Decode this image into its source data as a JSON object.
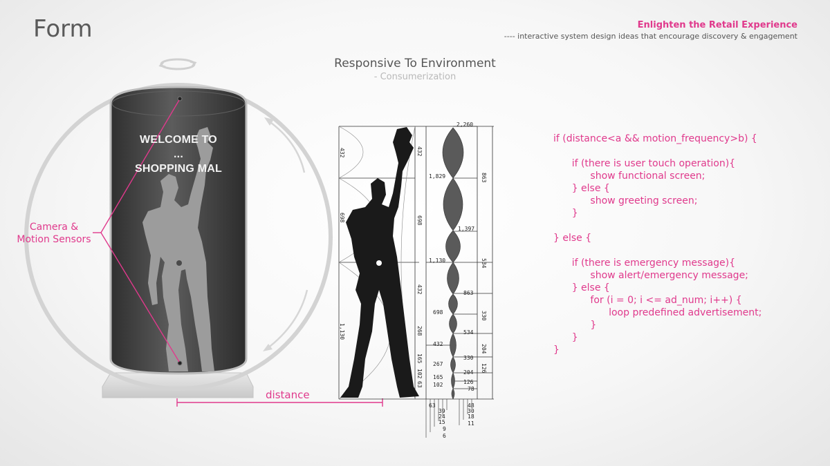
{
  "slide": {
    "title": "Form",
    "header_title": "Enlighten the Retail Experience",
    "header_subtitle": "---- interactive system design ideas that encourage discovery & engagement"
  },
  "section": {
    "title": "Responsive To Environment",
    "subtitle": "- Consumerization"
  },
  "kiosk": {
    "welcome_lines": [
      "WELCOME TO",
      "...",
      "SHOPPING MAL"
    ],
    "sensor_label_lines": [
      "Camera &",
      "Motion Sensors"
    ],
    "distance_label": "distance"
  },
  "modulor": {
    "left_labels": [
      "432",
      "698",
      "1,130"
    ],
    "middle_labels": [
      "432",
      "698",
      "432",
      "268",
      "165",
      "102",
      "63"
    ],
    "center_labels": [
      "2,260",
      "1,829",
      "1,397",
      "1,130",
      "863",
      "698",
      "534",
      "432",
      "330",
      "267",
      "204",
      "165",
      "126",
      "102",
      "78"
    ],
    "right_labels": [
      "863",
      "534",
      "330",
      "204",
      "126"
    ],
    "bottom_left": [
      "63",
      "39",
      "24",
      "15",
      "9",
      "6"
    ],
    "bottom_right": [
      "48",
      "30",
      "18",
      "11"
    ]
  },
  "code": [
    "if (distance<a && motion_frequency>b) {",
    "",
    "      if (there is user touch operation){",
    "            show functional screen;",
    "      } else {",
    "            show greeting screen;",
    "      }",
    "",
    "} else {",
    "",
    "      if (there is emergency message){",
    "            show alert/emergency message;",
    "      } else {",
    "            for (i = 0; i <= ad_num; i++) {",
    "                  loop predefined advertisement;",
    "            }",
    "      }",
    "}"
  ],
  "colors": {
    "accent": "#e0398c",
    "kiosk_body": "#4a4a4a",
    "ring": "#d0d0d0"
  }
}
